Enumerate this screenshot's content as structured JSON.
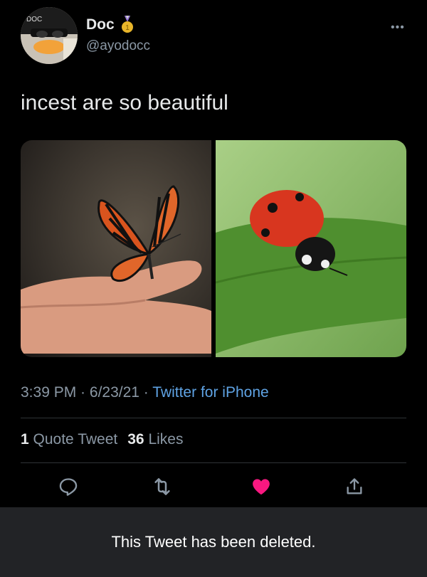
{
  "author": {
    "display_name": "Doc",
    "handle": "@ayodocc",
    "badge_icon": "medal-icon",
    "avatar_icon": "duck-avatar"
  },
  "more_icon": "more-icon",
  "tweet": {
    "text": "incest are so beautiful",
    "media": [
      {
        "name": "butterfly-photo"
      },
      {
        "name": "ladybug-photo"
      }
    ]
  },
  "meta": {
    "time": "3:39 PM",
    "sep1": " · ",
    "date": "6/23/21",
    "sep2": " · ",
    "source": "Twitter for iPhone"
  },
  "stats": {
    "quote_count": "1",
    "quote_label": "Quote Tweet",
    "like_count": "36",
    "like_label": "Likes"
  },
  "actions": [
    "reply-icon",
    "retweet-icon",
    "like-icon",
    "share-icon"
  ],
  "colors": {
    "background": "#000000",
    "secondary_text": "#8b98a5",
    "link": "#5fa3e4",
    "like": "#f91880",
    "banner": "#222326"
  },
  "banner": {
    "text": "This Tweet has been deleted."
  }
}
